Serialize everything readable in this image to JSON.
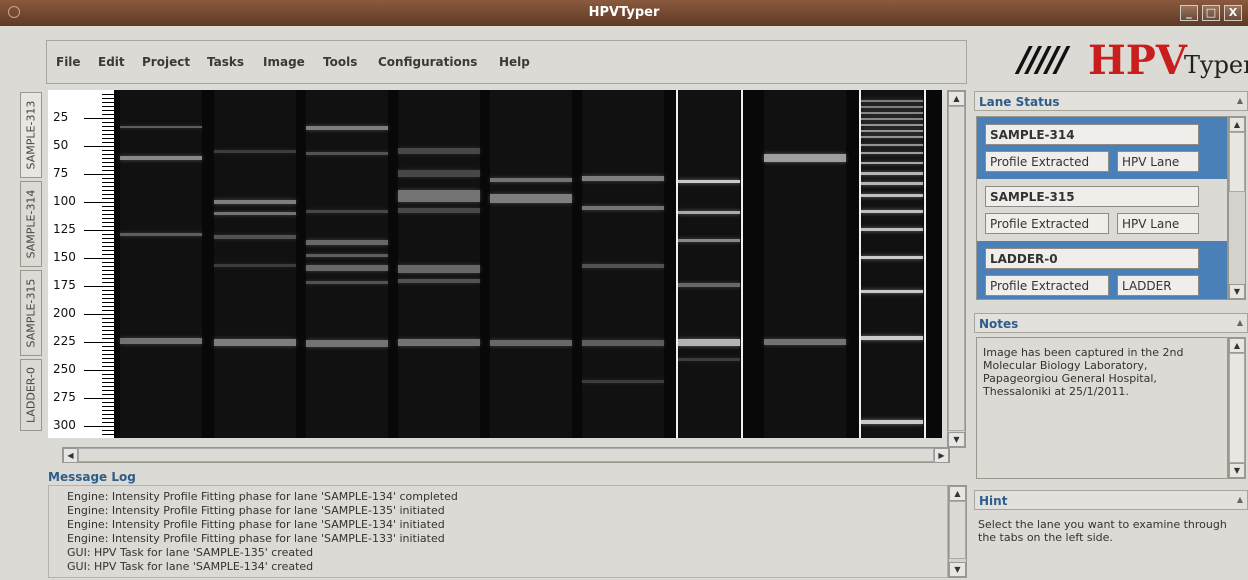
{
  "window": {
    "title": "HPVTyper",
    "min": "_",
    "max": "□",
    "close": "X"
  },
  "menu": [
    "File",
    "Edit",
    "Project",
    "Tasks",
    "Image",
    "Tools",
    "Configurations",
    "Help"
  ],
  "logo": {
    "bars": "/////",
    "hpv": "HPV",
    "typer": "Typer"
  },
  "lane_tabs": [
    "SAMPLE-313",
    "SAMPLE-314",
    "SAMPLE-315",
    "LADDER-0"
  ],
  "ruler_labels": [
    "25",
    "50",
    "75",
    "100",
    "125",
    "150",
    "175",
    "200",
    "225",
    "250",
    "275",
    "300"
  ],
  "message_log": {
    "title": "Message Log",
    "lines": [
      "Engine: Intensity Profile Fitting phase for lane 'SAMPLE-134' completed",
      "Engine: Intensity Profile Fitting phase for lane 'SAMPLE-135' initiated",
      "Engine: Intensity Profile Fitting phase for lane 'SAMPLE-134' initiated",
      "Engine: Intensity Profile Fitting phase for lane 'SAMPLE-133' initiated",
      "GUI: HPV Task for lane 'SAMPLE-135' created",
      "GUI: HPV Task for lane 'SAMPLE-134' created"
    ]
  },
  "lane_status": {
    "title": "Lane Status",
    "entries": [
      {
        "name": "SAMPLE-314",
        "status": "Profile Extracted",
        "type": "HPV Lane",
        "selected": true
      },
      {
        "name": "SAMPLE-315",
        "status": "Profile Extracted",
        "type": "HPV Lane",
        "selected": false
      },
      {
        "name": "LADDER-0",
        "status": "Profile Extracted",
        "type": "LADDER",
        "selected": true
      }
    ]
  },
  "notes": {
    "title": "Notes",
    "text": "Image has been captured in the 2nd Molecular Biology Laboratory, Papageorgiou General Hospital, Thessaloniki at 25/1/2011."
  },
  "hint": {
    "title": "Hint",
    "text": "Select the lane you want to examine through the tabs on the left side."
  },
  "colors": {
    "title_bar": "#6e4630",
    "accent_blue": "#2f5d8a",
    "selected_row": "#4a7fb8",
    "logo_red": "#c81e1e"
  }
}
